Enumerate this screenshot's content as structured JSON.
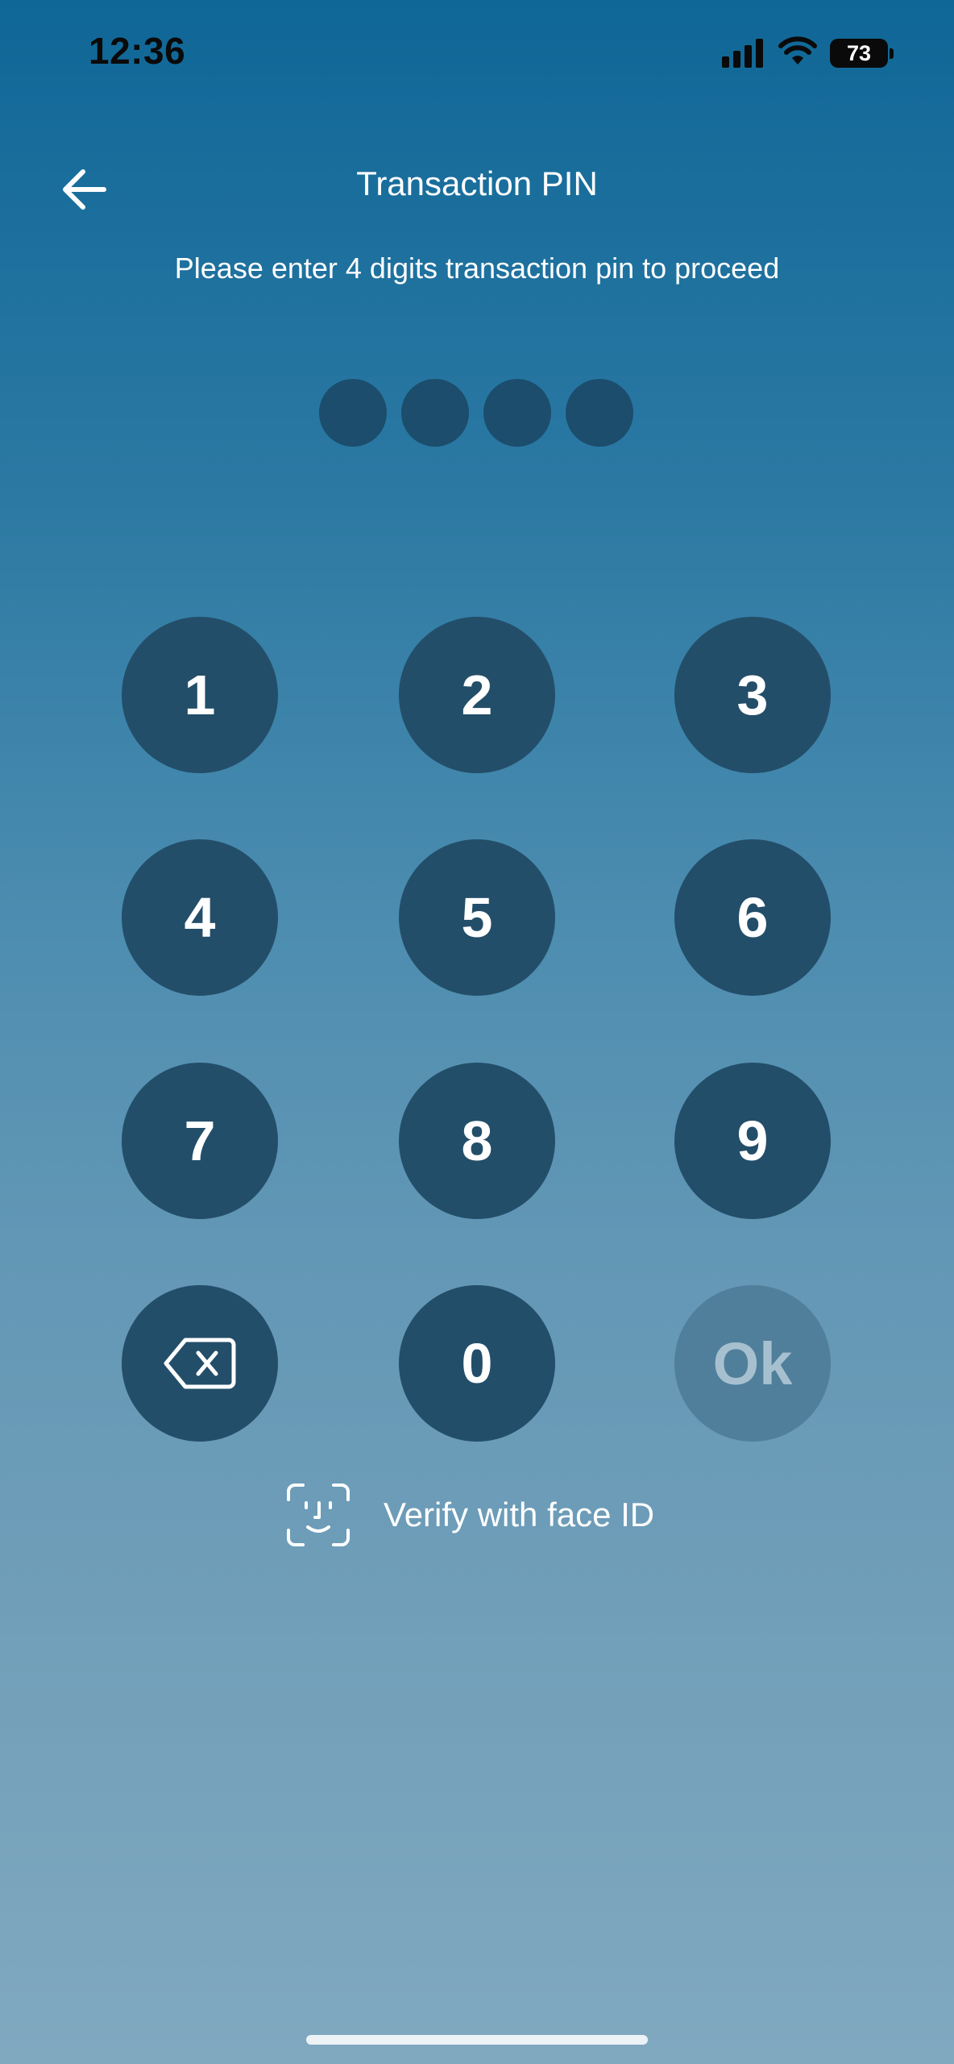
{
  "status_bar": {
    "time": "12:36",
    "battery": "73"
  },
  "header": {
    "back_icon": "arrow-left-icon",
    "title": "Transaction PIN",
    "subtitle": "Please enter 4 digits transaction pin to proceed"
  },
  "pin": {
    "length": 4
  },
  "keypad": {
    "k1": "1",
    "k2": "2",
    "k3": "3",
    "k4": "4",
    "k5": "5",
    "k6": "6",
    "k7": "7",
    "k8": "8",
    "k9": "9",
    "backspace_icon": "backspace-icon",
    "k0": "0",
    "ok": "Ok"
  },
  "face_id": {
    "icon": "face-id-icon",
    "label": "Verify with face ID"
  },
  "colors": {
    "gradient_top": "#0f6797",
    "gradient_bottom": "#80a9c0",
    "key_bg": "#234e69",
    "ok_bg": "#4f7f9b",
    "pin_dot": "#1c4d6c"
  }
}
